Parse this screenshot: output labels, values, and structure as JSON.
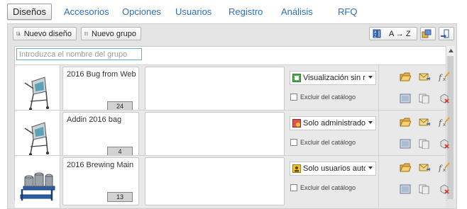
{
  "tabs": [
    {
      "label": "Diseños",
      "active": true
    },
    {
      "label": "Accesorios"
    },
    {
      "label": "Opciones"
    },
    {
      "label": "Usuarios"
    },
    {
      "label": "Registro"
    },
    {
      "label": "Análisis"
    },
    {
      "label": "RFQ"
    }
  ],
  "toolbar": {
    "new_design_label": "Nuevo diseño",
    "new_group_label": "Nuevo grupo",
    "sort_label": "A → Z"
  },
  "search": {
    "placeholder": "Introduzca el nombre del grupo"
  },
  "rows": [
    {
      "name": "2016 Bug from Web",
      "count": "24",
      "permission": "Visualización sin re...",
      "permission_icon": "green-view-icon",
      "exclude_label": "Excluir del catálogo"
    },
    {
      "name": "Addin 2016 bag",
      "count": "4",
      "permission": "Solo administradores",
      "permission_icon": "red-admin-icon",
      "exclude_label": "Excluir del catálogo"
    },
    {
      "name": "2016 Brewing Main",
      "count": "13",
      "permission": "Solo usuarios autor...",
      "permission_icon": "yellow-user-icon",
      "exclude_label": "Excluir del catálogo"
    }
  ],
  "colors": {
    "tab_link": "#2c6fbd",
    "panel_bg": "#e4e4e4",
    "row_bg": "#e9e9e9",
    "search_border": "#6ea6da"
  }
}
